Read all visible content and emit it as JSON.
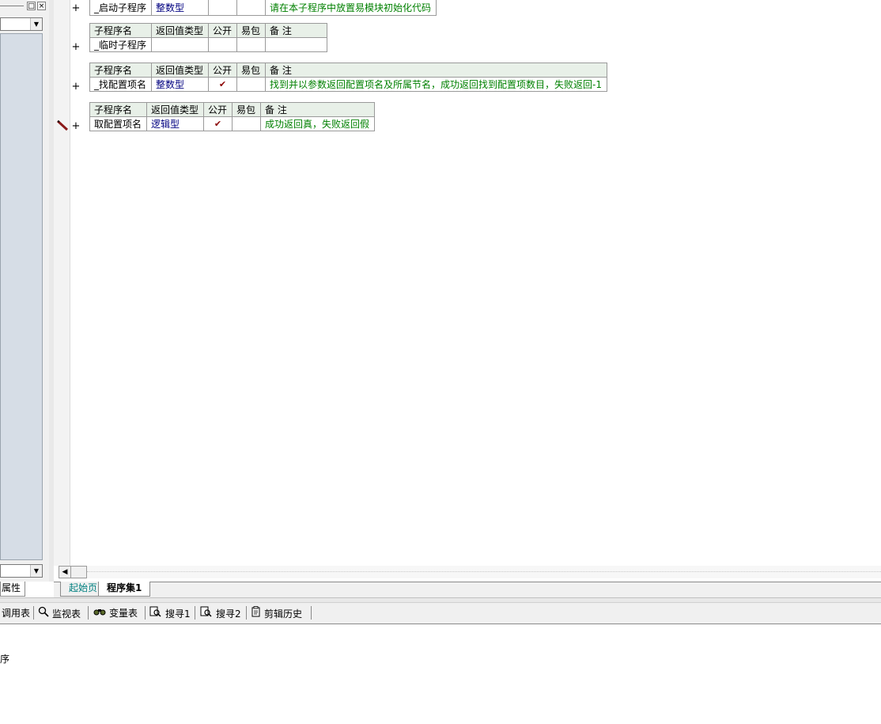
{
  "left_panel": {
    "tab_label": "属性",
    "window_buttons": [
      "□",
      "×"
    ]
  },
  "subprograms": [
    {
      "name": "_启动子程序",
      "return_type": "整数型",
      "public": false,
      "note": "请在本子程序中放置易模块初始化代码",
      "show_header": false
    },
    {
      "name": "_临时子程序",
      "return_type": "",
      "public": false,
      "note": "",
      "show_header": true
    },
    {
      "name": "_找配置项名",
      "return_type": "整数型",
      "public": true,
      "note": "找到并以参数返回配置项名及所属节名，成功返回找到配置项数目，失败返回-1",
      "show_header": true
    },
    {
      "name": "取配置项名",
      "return_type": "逻辑型",
      "public": true,
      "note": "成功返回真，失败返回假",
      "show_header": true
    }
  ],
  "headers": {
    "name": "子程序名",
    "return_type": "返回值类型",
    "public": "公开",
    "package": "易包",
    "note": "备 注"
  },
  "check_mark": "✔",
  "expand_symbol": "+",
  "tabs": [
    "起始页",
    "程序集1"
  ],
  "toolbar": {
    "items": [
      {
        "label": "调用表",
        "icon": "call-table-icon"
      },
      {
        "label": "监视表",
        "icon": "magnifier-icon"
      },
      {
        "label": "变量表",
        "icon": "binoculars-icon"
      },
      {
        "label": "搜寻1",
        "icon": "search-doc-icon"
      },
      {
        "label": "搜寻2",
        "icon": "search-doc-icon"
      },
      {
        "label": "剪辑历史",
        "icon": "clipboard-icon"
      }
    ]
  },
  "output": {
    "text": "序"
  }
}
